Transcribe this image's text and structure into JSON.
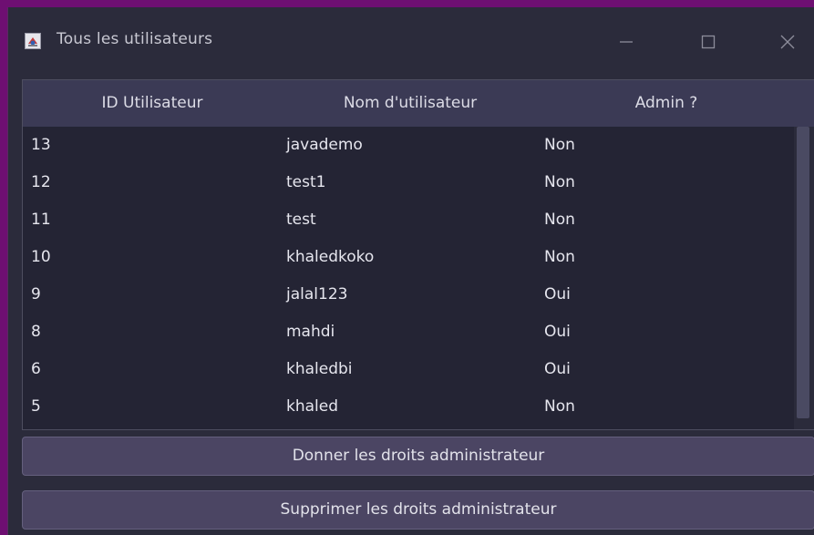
{
  "window": {
    "title": "Tous les utilisateurs",
    "icons": {
      "app": "java-app-icon",
      "minimize": "minimize-icon",
      "maximize": "maximize-icon",
      "close": "close-icon"
    }
  },
  "table": {
    "columns": [
      "ID Utilisateur",
      "Nom d'utilisateur",
      "Admin ?"
    ],
    "rows": [
      {
        "id": "13",
        "name": "javademo",
        "admin": "Non"
      },
      {
        "id": "12",
        "name": "test1",
        "admin": "Non"
      },
      {
        "id": "11",
        "name": "test",
        "admin": "Non"
      },
      {
        "id": "10",
        "name": "khaledkoko",
        "admin": "Non"
      },
      {
        "id": "9",
        "name": "jalal123",
        "admin": "Oui"
      },
      {
        "id": "8",
        "name": "mahdi",
        "admin": "Oui"
      },
      {
        "id": "6",
        "name": "khaledbi",
        "admin": "Oui"
      },
      {
        "id": "5",
        "name": "khaled",
        "admin": "Non"
      }
    ]
  },
  "actions": {
    "grant_label": "Donner les droits administrateur",
    "revoke_label": "Supprimer les droits administrateur"
  },
  "colors": {
    "window_bg": "#2b2b3b",
    "header_bg": "#3b3a55",
    "button_bg": "#4b4563",
    "frame": "#6e0f72"
  }
}
